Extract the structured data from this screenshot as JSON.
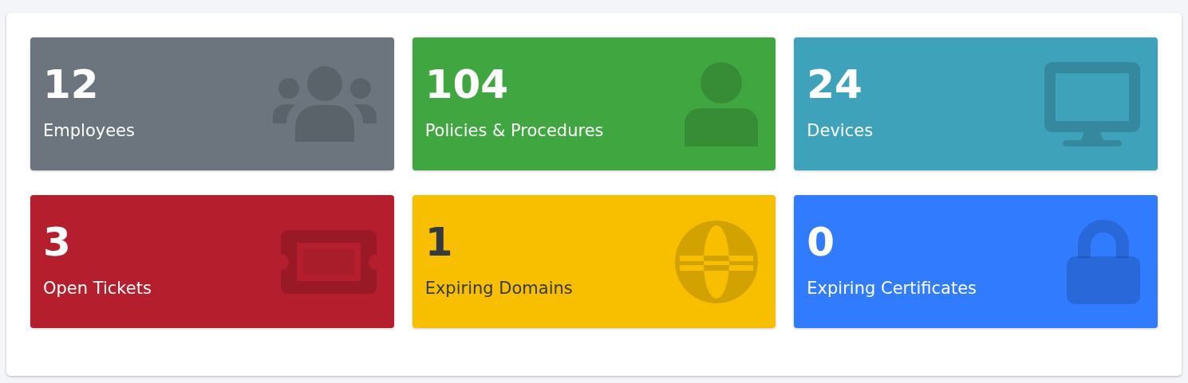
{
  "cards": [
    {
      "value": "12",
      "label": "Employees",
      "color": "#6c757d"
    },
    {
      "value": "104",
      "label": "Policies & Procedures",
      "color": "#40a63f"
    },
    {
      "value": "24",
      "label": "Devices",
      "color": "#3ea2bb"
    },
    {
      "value": "3",
      "label": "Open Tickets",
      "color": "#b41e2d"
    },
    {
      "value": "1",
      "label": "Expiring Domains",
      "color": "#f7bf00"
    },
    {
      "value": "0",
      "label": "Expiring Certificates",
      "color": "#317bfe"
    }
  ]
}
